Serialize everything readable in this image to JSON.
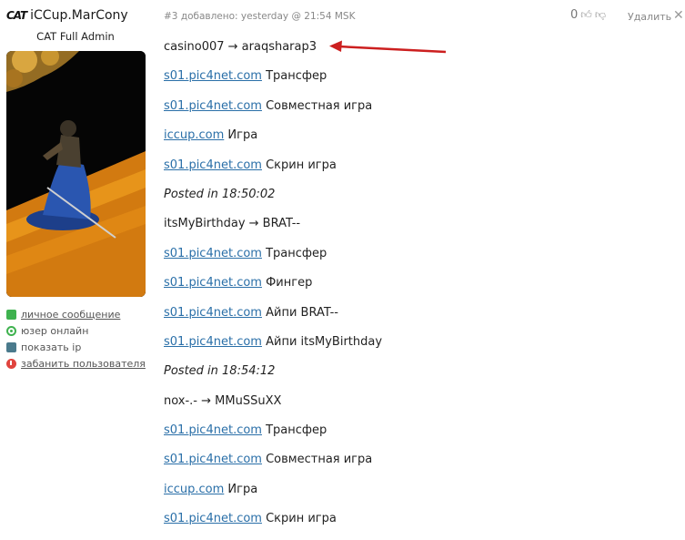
{
  "user": {
    "badge": "CAT",
    "name": "iCCup.MarCony",
    "rank": "CAT Full Admin"
  },
  "actions": [
    {
      "label": "личное сообщение",
      "icon": "message-icon",
      "color": "#3fb24f",
      "link": true
    },
    {
      "label": "юзер онлайн",
      "icon": "online-status-icon",
      "color": "#3fb24f",
      "link": false
    },
    {
      "label": "показать ip",
      "icon": "monitor-icon",
      "color": "#4a7a8c",
      "link": false
    },
    {
      "label": "забанить пользователя",
      "icon": "ban-icon",
      "color": "#e0443e",
      "link": true
    }
  ],
  "post": {
    "meta": "#3 добавлено: yesterday @ 21:54 MSK",
    "votes": "0",
    "delete_label": "Удалить",
    "close_label": "✕"
  },
  "lines": [
    {
      "text": "casino007 → araqsharap3"
    },
    {
      "link": "s01.pic4net.com",
      "text": " Трансфер"
    },
    {
      "link": "s01.pic4net.com",
      "text": " Совместная игра"
    },
    {
      "link": "iccup.com",
      "text": " Игра"
    },
    {
      "link": "s01.pic4net.com",
      "text": " Скрин игра"
    },
    {
      "text": "Posted in 18:50:02",
      "italic": true
    },
    {
      "text": "itsMyBirthday → BRAT--"
    },
    {
      "link": "s01.pic4net.com",
      "text": " Трансфер"
    },
    {
      "link": "s01.pic4net.com",
      "text": " Фингер"
    },
    {
      "link": "s01.pic4net.com",
      "text": " Айпи BRAT--"
    },
    {
      "link": "s01.pic4net.com",
      "text": " Айпи itsMyBirthday"
    },
    {
      "text": "Posted in 18:54:12",
      "italic": true
    },
    {
      "text": "nox-.- → MMuSSuXX"
    },
    {
      "link": "s01.pic4net.com",
      "text": " Трансфер"
    },
    {
      "link": "s01.pic4net.com",
      "text": " Совместная игра"
    },
    {
      "link": "iccup.com",
      "text": " Игра"
    },
    {
      "link": "s01.pic4net.com",
      "text": " Скрин игра"
    }
  ],
  "colors": {
    "link": "#2a6fa8",
    "annotation_arrow": "#cc1f1f"
  }
}
